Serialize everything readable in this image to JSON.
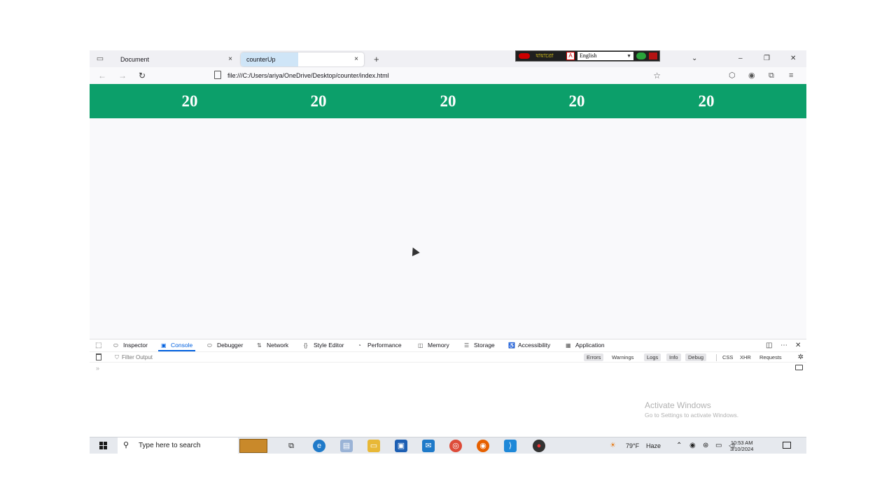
{
  "tabs": [
    {
      "label": "Document",
      "close": "×"
    },
    {
      "label": "counterUp",
      "close": "×"
    }
  ],
  "new_tab": "+",
  "toolbar_overlay": {
    "logo_text": "যায়াত্রো",
    "language": "English"
  },
  "window_controls": {
    "list": "⌄",
    "minimize": "–",
    "restore": "❐",
    "close": "✕"
  },
  "nav": {
    "back": "←",
    "forward": "→",
    "reload": "↻",
    "url": "file:///C:/Users/ariya/OneDrive/Desktop/counter/index.html",
    "star": "☆"
  },
  "counters": [
    "20",
    "20",
    "20",
    "20",
    "20"
  ],
  "devtools": {
    "tabs": [
      {
        "label": "Inspector",
        "icon": "⬭"
      },
      {
        "label": "Console",
        "icon": "▣",
        "active": true
      },
      {
        "label": "Debugger",
        "icon": "⬭"
      },
      {
        "label": "Network",
        "icon": "⇅"
      },
      {
        "label": "Style Editor",
        "icon": "{}"
      },
      {
        "label": "Performance",
        "icon": "◔"
      },
      {
        "label": "Memory",
        "icon": "◫"
      },
      {
        "label": "Storage",
        "icon": "☰"
      },
      {
        "label": "Accessibility",
        "icon": "♿"
      },
      {
        "label": "Application",
        "icon": "▦"
      }
    ],
    "filter_placeholder": "Filter Output",
    "levels": [
      {
        "label": "Errors",
        "on": true
      },
      {
        "label": "Warnings",
        "on": false
      },
      {
        "label": "Logs",
        "on": true
      },
      {
        "label": "Info",
        "on": true
      },
      {
        "label": "Debug",
        "on": true
      }
    ],
    "types": [
      "CSS",
      "XHR",
      "Requests"
    ],
    "prompt": "»"
  },
  "watermark": {
    "line1": "Activate Windows",
    "line2": "Go to Settings to activate Windows."
  },
  "taskbar": {
    "search_placeholder": "Type here to search",
    "weather_temp": "79°F",
    "weather_cond": "Haze",
    "time": "10:53 AM",
    "date": "3/10/2024"
  },
  "colors": {
    "counter_band": "#0c9f6a",
    "active_tab": "#0060df"
  }
}
